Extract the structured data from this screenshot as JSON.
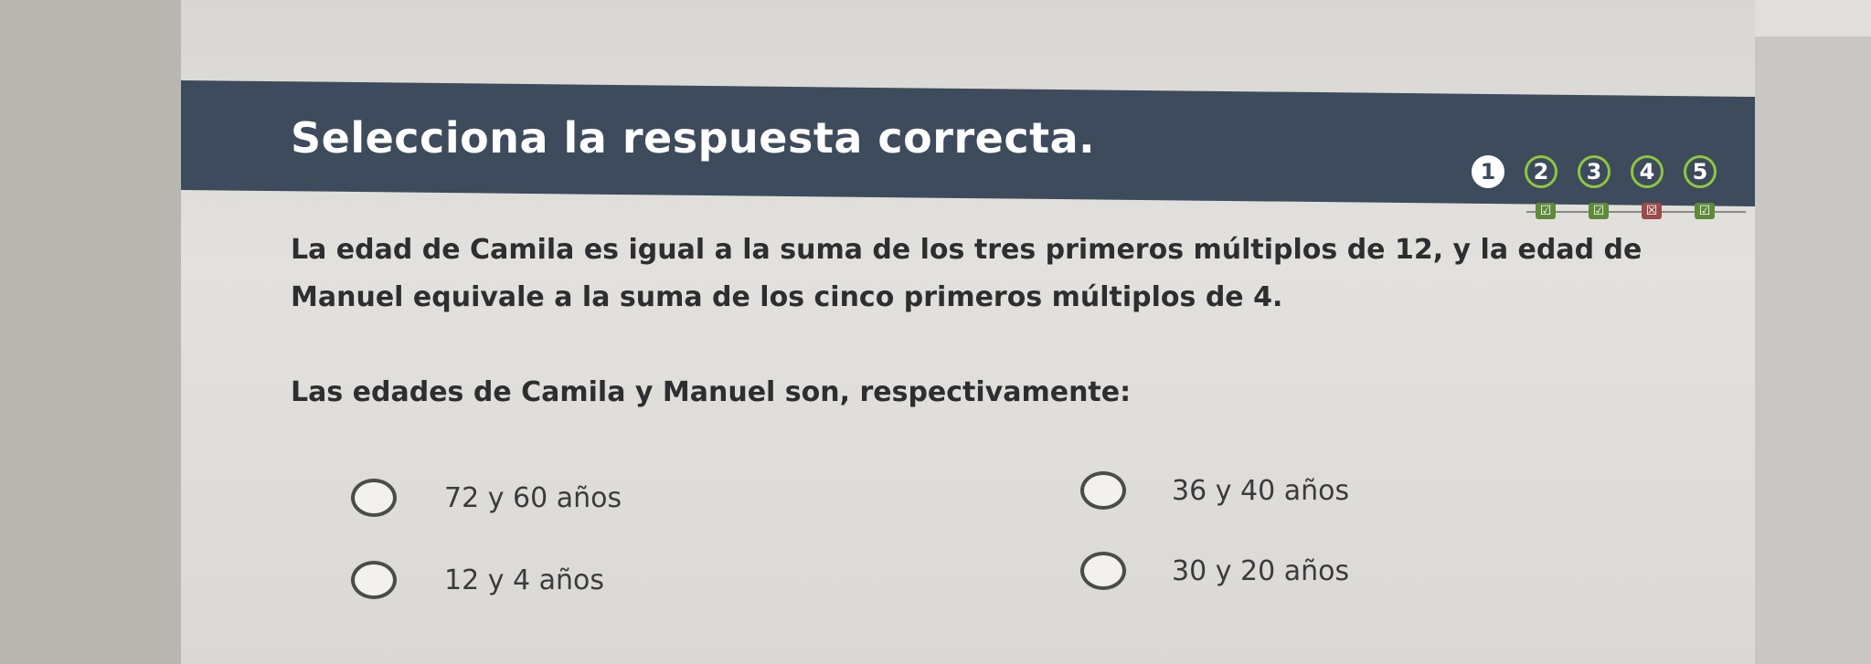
{
  "header": {
    "title": "Selecciona la respuesta correcta."
  },
  "progress": {
    "steps": [
      "1",
      "2",
      "3",
      "4",
      "5"
    ],
    "marks": [
      "☑",
      "☑",
      "☒",
      "☑"
    ]
  },
  "question": {
    "statement_line1": "La edad de Camila es igual a la suma de los tres primeros múltiplos de 12, y la edad de",
    "statement_line2": "Manuel equivale a la suma de los cinco primeros múltiplos de 4.",
    "prompt": "Las edades de Camila y Manuel son, respectivamente:"
  },
  "options": [
    {
      "label": "72 y 60 años"
    },
    {
      "label": "36 y 40 años"
    },
    {
      "label": "12 y 4 años"
    },
    {
      "label": "30 y 20 años"
    }
  ],
  "colors": {
    "header_bg": "#3d4b5c",
    "done_step": "#8fc63f",
    "correct_mark": "#5f8a3a",
    "wrong_mark": "#9a4b4b"
  }
}
